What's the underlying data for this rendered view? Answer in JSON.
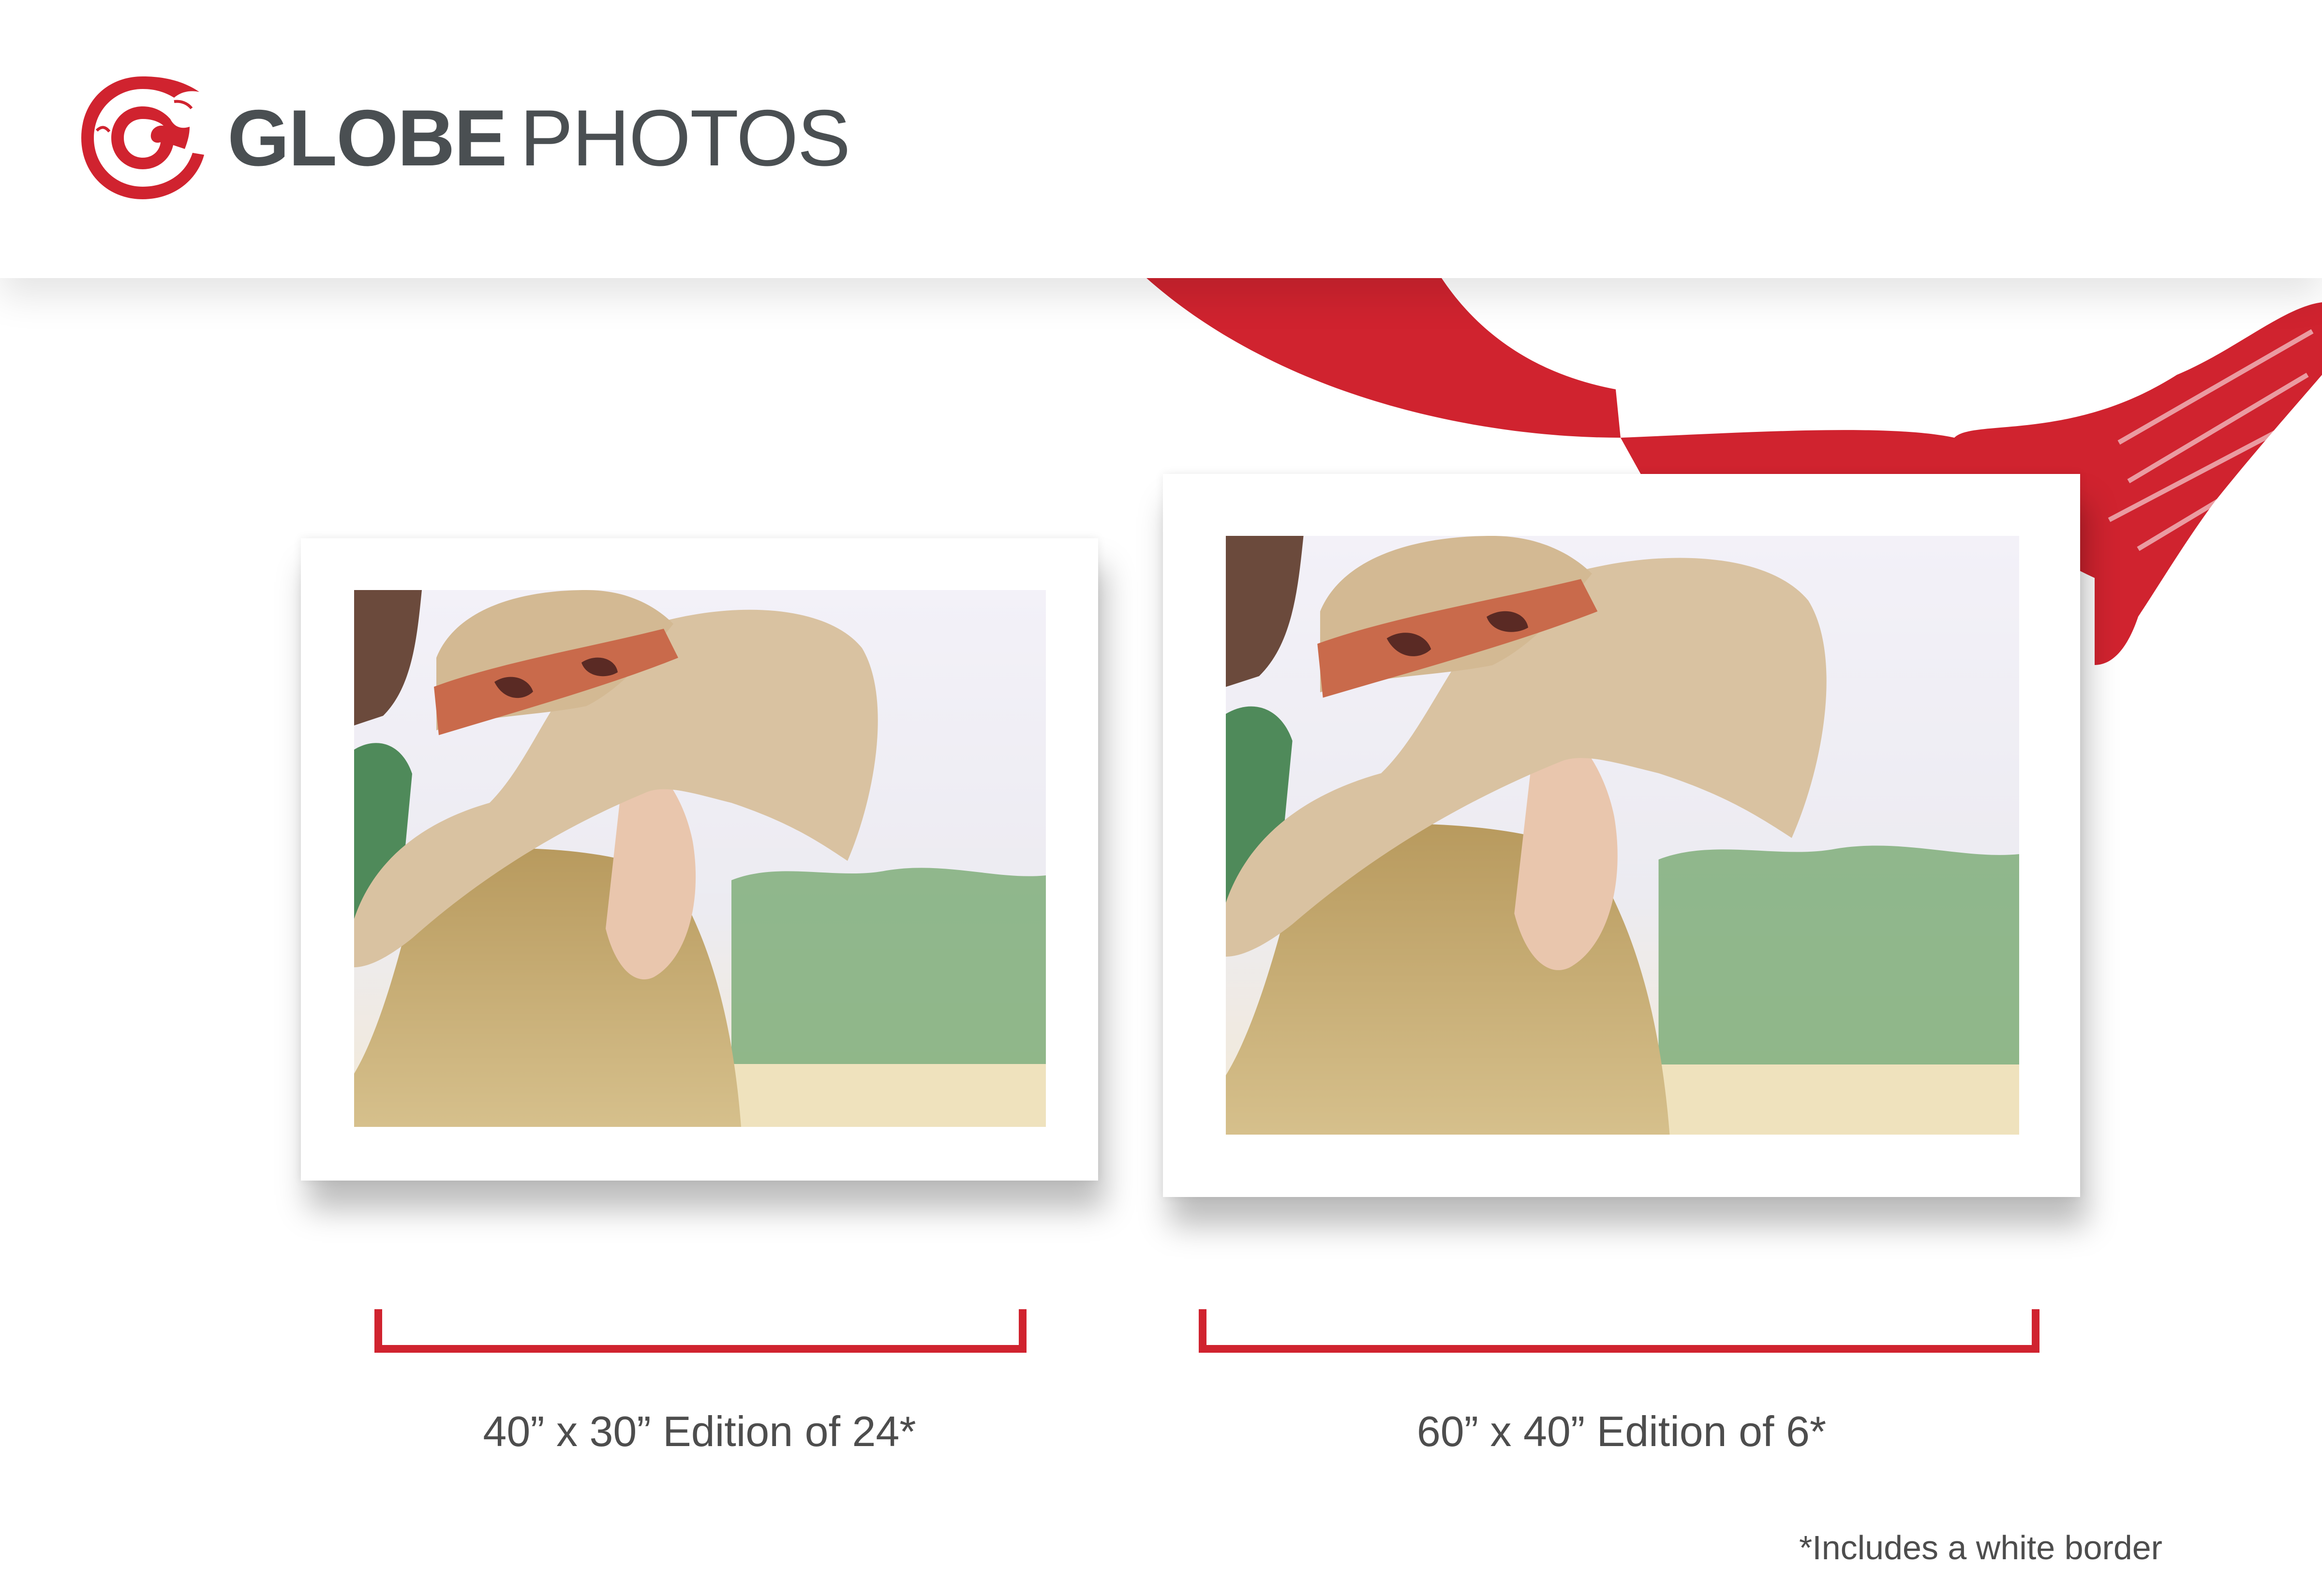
{
  "brand": {
    "name_bold": "GLOBE",
    "name_light": "PHOTOS",
    "logo_icon": "brush-circle-logo-icon",
    "accent_color": "#d0232f",
    "text_color": "#4a4f52"
  },
  "prints": [
    {
      "caption": "40” x 30” Edition of 24*"
    },
    {
      "caption": "60” x 40” Edition of 6*"
    }
  ],
  "footnote": "*Includes a white border"
}
